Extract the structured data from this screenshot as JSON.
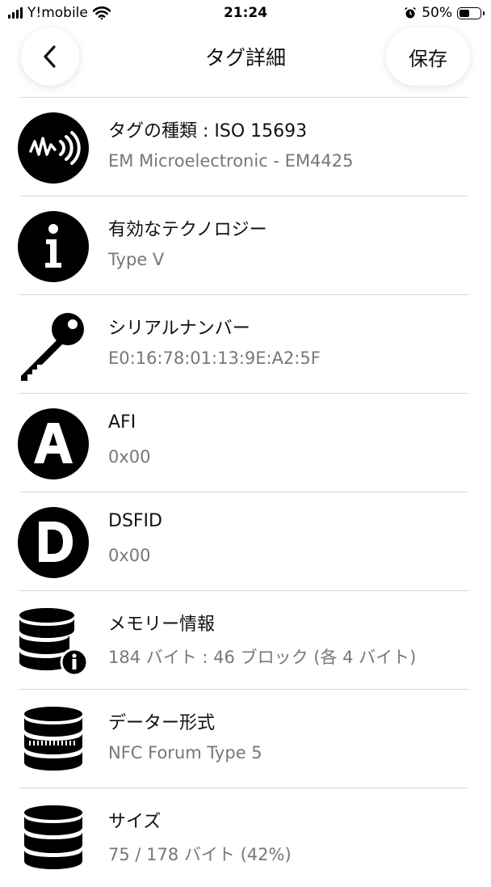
{
  "status_bar": {
    "carrier": "Y!mobile",
    "time": "21:24",
    "battery": "50%"
  },
  "nav": {
    "title": "タグ詳細",
    "save_label": "保存"
  },
  "rows": [
    {
      "icon": "nfc-wave-icon",
      "title": "タグの種類 : ISO 15693",
      "value": "EM Microelectronic - EM4425"
    },
    {
      "icon": "info-icon",
      "title": "有効なテクノロジー",
      "value": "Type V"
    },
    {
      "icon": "key-icon",
      "title": "シリアルナンバー",
      "value": "E0:16:78:01:13:9E:A2:5F"
    },
    {
      "icon": "letter-a-icon",
      "title": "AFI",
      "value": "0x00"
    },
    {
      "icon": "letter-d-icon",
      "title": "DSFID",
      "value": "0x00"
    },
    {
      "icon": "database-info-icon",
      "title": "メモリー情報",
      "value": "184 バイト : 46 ブロック (各 4 バイト)"
    },
    {
      "icon": "database-format-icon",
      "title": "データー形式",
      "value": "NFC Forum Type 5"
    },
    {
      "icon": "database-size-icon",
      "title": "サイズ",
      "value": "75 / 178 バイト (42%)"
    }
  ]
}
